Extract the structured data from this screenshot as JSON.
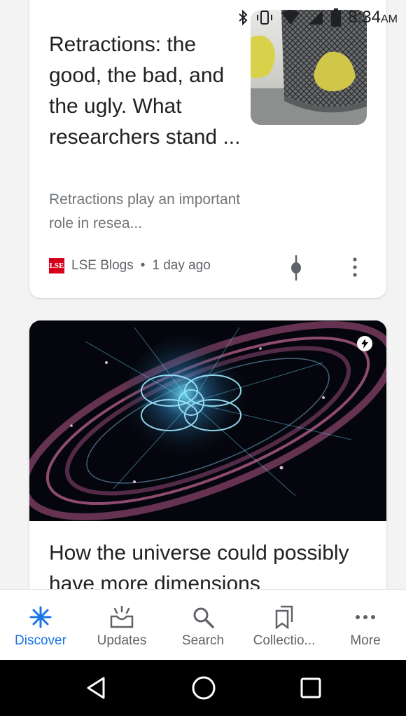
{
  "status_bar": {
    "time": "8:34",
    "ampm": "AM"
  },
  "cards": [
    {
      "title": "Retractions: the good, the bad, and the ugly. What researchers stand ...",
      "snippet": "Retractions play an important role in resea...",
      "source": "LSE Blogs",
      "source_logo": "LSE",
      "separator": "•",
      "age": "1 day ago"
    },
    {
      "title": "How the universe could possibly have more dimensions"
    }
  ],
  "bottom_nav": [
    {
      "label": "Discover",
      "icon": "discover-icon",
      "active": true
    },
    {
      "label": "Updates",
      "icon": "updates-icon"
    },
    {
      "label": "Search",
      "icon": "search-icon"
    },
    {
      "label": "Collectio...",
      "icon": "collections-icon"
    },
    {
      "label": "More",
      "icon": "more-horizontal-icon"
    }
  ],
  "colors": {
    "accent": "#1a73e8",
    "text": "#202124",
    "secondary": "#70757a",
    "lse_red": "#d6001c"
  }
}
